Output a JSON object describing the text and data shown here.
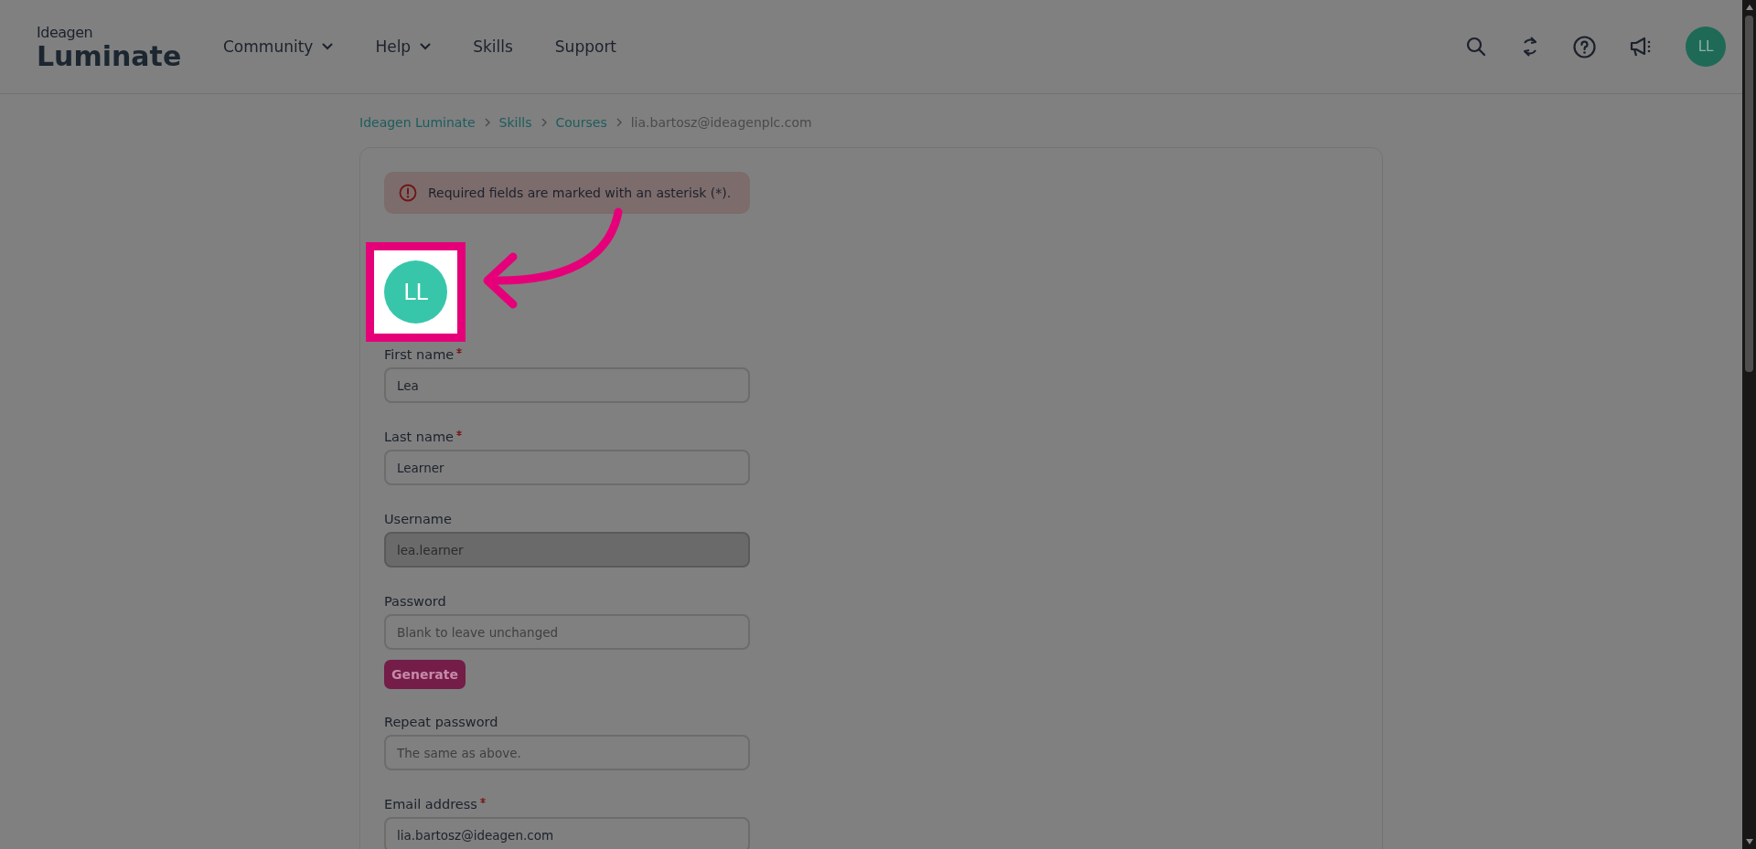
{
  "header": {
    "logo": {
      "brand": "Ideagen",
      "product": "Luminate"
    },
    "nav": [
      {
        "label": "Community",
        "dropdown": true
      },
      {
        "label": "Help",
        "dropdown": true
      },
      {
        "label": "Skills",
        "dropdown": false
      },
      {
        "label": "Support",
        "dropdown": false
      }
    ],
    "user_avatar": {
      "initials": "LL"
    }
  },
  "breadcrumb": [
    {
      "label": "Ideagen Luminate",
      "link": true
    },
    {
      "label": "Skills",
      "link": true
    },
    {
      "label": "Courses",
      "link": true
    },
    {
      "label": "lia.bartosz@ideagenplc.com",
      "link": false
    }
  ],
  "alert": {
    "text": "Required fields are marked with an asterisk (*)."
  },
  "avatar": {
    "initials": "LL",
    "highlighted": true
  },
  "fields": [
    {
      "kind": "input",
      "label": "First name",
      "required": true,
      "value": "Lea",
      "disabled": false
    },
    {
      "kind": "input",
      "label": "Last name",
      "required": true,
      "value": "Learner",
      "disabled": false
    },
    {
      "kind": "input",
      "label": "Username",
      "required": false,
      "value": "lea.learner",
      "disabled": true
    },
    {
      "kind": "input",
      "label": "Password",
      "required": false,
      "placeholder": "Blank to leave unchanged",
      "disabled": false
    },
    {
      "kind": "button",
      "label": "Generate"
    },
    {
      "kind": "input",
      "label": "Repeat password",
      "required": false,
      "placeholder": "The same as above.",
      "disabled": false
    },
    {
      "kind": "input",
      "label": "Email address",
      "required": true,
      "value": "lia.bartosz@ideagen.com",
      "disabled": false
    }
  ]
}
